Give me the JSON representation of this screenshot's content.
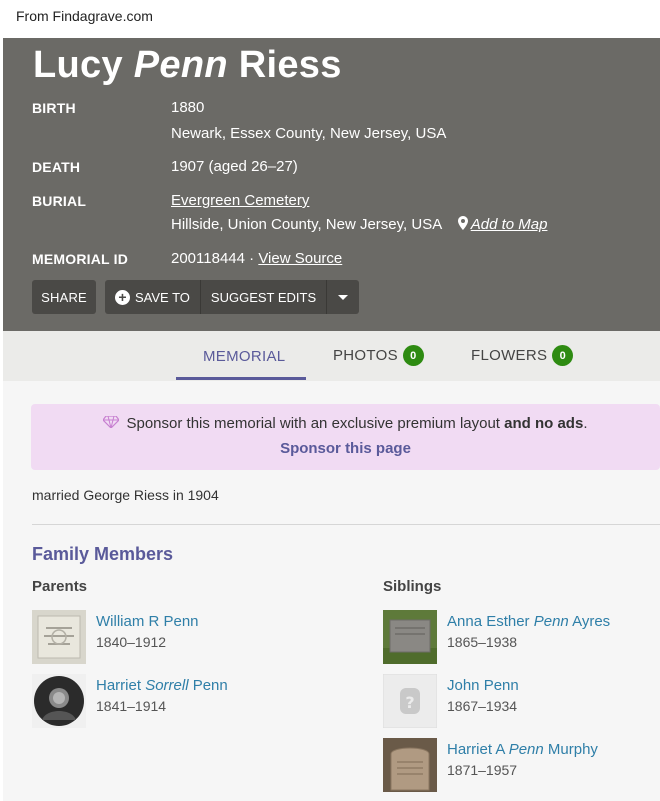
{
  "source_note": "From Findagrave.com",
  "memorial": {
    "name_first": "Lucy",
    "name_middle": "Penn",
    "name_last": "Riess",
    "birth_label": "BIRTH",
    "birth_date": "1880",
    "birth_place": "Newark, Essex County, New Jersey, USA",
    "death_label": "DEATH",
    "death_value": "1907 (aged 26–27)",
    "burial_label": "BURIAL",
    "burial_cemetery": "Evergreen Cemetery",
    "burial_place": "Hillside, Union County, New Jersey, USA",
    "add_to_map": "Add to Map",
    "memorial_id_label": "MEMORIAL ID",
    "memorial_id": "200118444",
    "separator": " · ",
    "view_source": "View Source"
  },
  "actions": {
    "share": "SHARE",
    "save_to": "SAVE TO",
    "suggest_edits": "SUGGEST EDITS"
  },
  "tabs": [
    {
      "label": "MEMORIAL"
    },
    {
      "label": "PHOTOS",
      "count": "0"
    },
    {
      "label": "FLOWERS",
      "count": "0"
    }
  ],
  "sponsor": {
    "text": "Sponsor this memorial with an exclusive premium layout ",
    "bold": "and no ads",
    "end": ".",
    "link": "Sponsor this page"
  },
  "bio": "married George Riess in 1904",
  "family": {
    "title": "Family Members",
    "parents_title": "Parents",
    "siblings_title": "Siblings",
    "parents": [
      {
        "name_pre": "William R Penn",
        "name_it": "",
        "name_post": "",
        "dates": "1840–1912"
      },
      {
        "name_pre": "Harriet ",
        "name_it": "Sorrell",
        "name_post": " Penn",
        "dates": "1841–1914"
      }
    ],
    "siblings": [
      {
        "name_pre": "Anna Esther ",
        "name_it": "Penn",
        "name_post": " Ayres",
        "dates": "1865–1938"
      },
      {
        "name_pre": "John Penn",
        "name_it": "",
        "name_post": "",
        "dates": "1867–1934"
      },
      {
        "name_pre": "Harriet A ",
        "name_it": "Penn",
        "name_post": " Murphy",
        "dates": "1871–1957"
      }
    ]
  }
}
